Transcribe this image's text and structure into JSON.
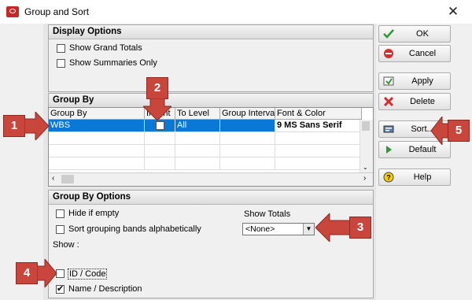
{
  "window": {
    "title": "Group and Sort",
    "close": "✕"
  },
  "display_options": {
    "header": "Display Options",
    "show_grand_totals": "Show Grand Totals",
    "show_summaries_only": "Show Summaries Only"
  },
  "group_by": {
    "header": "Group By",
    "columns": [
      "Group By",
      "Indent",
      "To Level",
      "Group Interval",
      "Font & Color"
    ],
    "rows": [
      {
        "group_by": "WBS",
        "indent": "",
        "to_level": "All",
        "group_interval": "",
        "font_color": "9 MS Sans Serif"
      }
    ]
  },
  "group_by_options": {
    "header": "Group By Options",
    "hide_if_empty": "Hide if empty",
    "sort_alpha": "Sort grouping bands alphabetically",
    "show_label": "Show :",
    "id_code": "ID / Code",
    "name_description": "Name / Description",
    "show_totals_label": "Show Totals",
    "show_totals_value": "<None>"
  },
  "buttons": {
    "ok": "OK",
    "cancel": "Cancel",
    "apply": "Apply",
    "delete": "Delete",
    "sort": "Sort...",
    "default": "Default",
    "help": "Help"
  },
  "callouts": [
    "1",
    "2",
    "3",
    "4",
    "5"
  ],
  "colors": {
    "callout": "#c8463c",
    "selection": "#0a78d7"
  }
}
